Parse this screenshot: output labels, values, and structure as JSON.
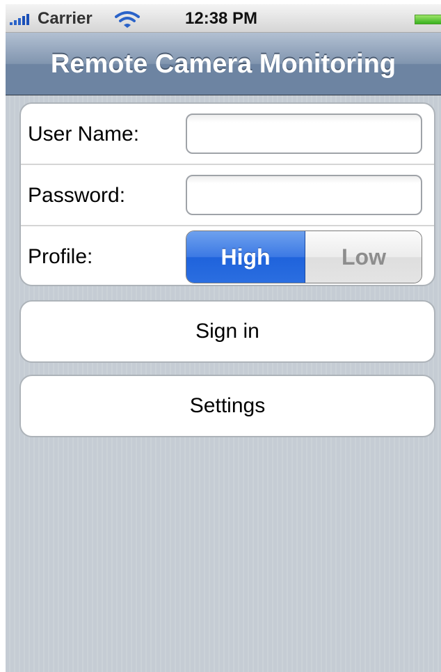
{
  "status_bar": {
    "carrier": "Carrier",
    "time": "12:38 PM",
    "icons": [
      "signal-bars-icon",
      "wifi-icon",
      "battery-icon"
    ]
  },
  "nav_bar": {
    "title": "Remote Camera Monitoring"
  },
  "form": {
    "username_label": "User Name:",
    "username_value": "",
    "password_label": "Password:",
    "password_value": "",
    "profile_label": "Profile:",
    "profile_options": [
      "High",
      "Low"
    ],
    "profile_selected": "High"
  },
  "buttons": {
    "sign_in": "Sign in",
    "settings": "Settings"
  },
  "colors": {
    "background": "#c5ccd4",
    "nav_bar": "#6d84a2",
    "segment_selected": "#2b6ee0",
    "battery": "#38b21e"
  }
}
